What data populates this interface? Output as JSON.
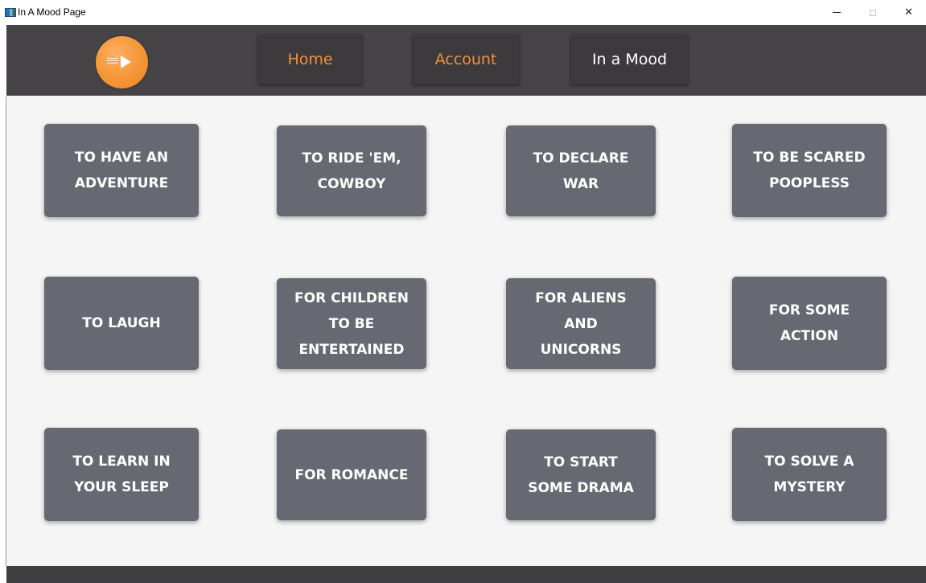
{
  "window": {
    "title": "In A Mood Page"
  },
  "nav": {
    "home_label": "Home",
    "account_label": "Account",
    "mood_label": "In a Mood",
    "accent_color": "#f0903a"
  },
  "moods": [
    [
      "TO HAVE AN\nADVENTURE",
      "TO RIDE 'EM,\nCOWBOY",
      "TO DECLARE\nWAR",
      "TO BE SCARED\nPOOPLESS"
    ],
    [
      "TO LAUGH",
      "FOR CHILDREN\nTO BE\nENTERTAINED",
      "FOR ALIENS\nAND\nUNICORNS",
      "FOR SOME\nACTION"
    ],
    [
      "TO LEARN IN\nYOUR SLEEP",
      "FOR ROMANCE",
      "TO START\nSOME DRAMA",
      "TO SOLVE A\nMYSTERY"
    ]
  ],
  "icons": {
    "app": "app-icon",
    "logo": "play-logo-icon",
    "minimize": "minimize-icon",
    "maximize": "maximize-icon",
    "close": "close-icon"
  }
}
